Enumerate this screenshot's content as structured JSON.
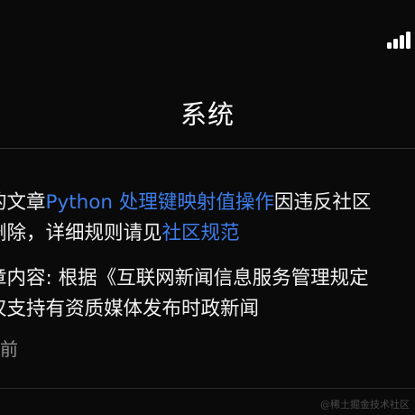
{
  "status_bar": {
    "signal_icon": "cellular-signal-icon"
  },
  "header": {
    "title": "系统"
  },
  "notification": {
    "line1_prefix": "的文章",
    "line1_article_link": "Python 处理键映射值操作",
    "line1_suffix": "因违反社区",
    "line2_prefix": "删除，详细规则请见",
    "line2_rules_link": "社区规范",
    "line3": "章内容: 根据《互联网新闻信息服务管理规定",
    "line4": "仅支持有资质媒体发布时政新闻",
    "timestamp": "时前"
  },
  "colors": {
    "background": "#0a0a0a",
    "text": "#f0f0f0",
    "link": "#3d7dea",
    "muted": "#8e8e8e"
  },
  "watermark": "@稀土掘金技术社区"
}
